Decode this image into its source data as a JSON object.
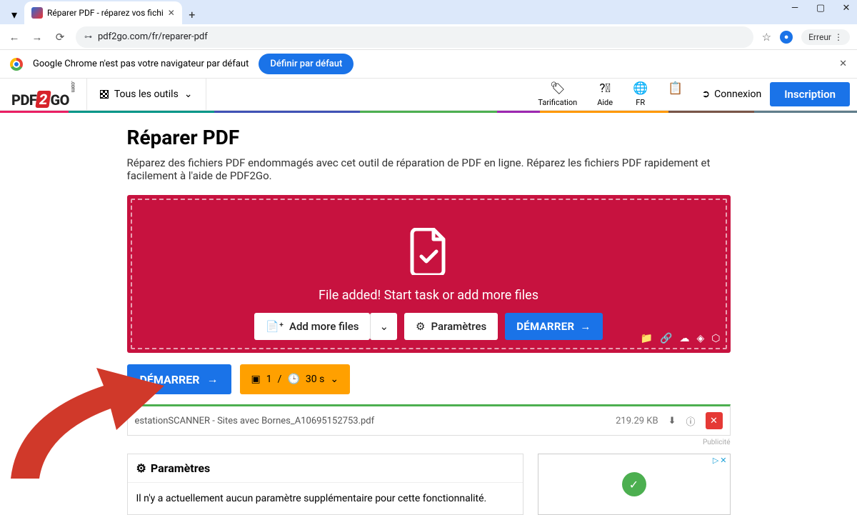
{
  "browser": {
    "tab_title": "Réparer PDF - réparez vos fichi",
    "url": "pdf2go.com/fr/reparer-pdf",
    "error_chip": "Erreur",
    "default_msg": "Google Chrome n'est pas votre navigateur par défaut",
    "define_btn": "Définir par défaut"
  },
  "header": {
    "logo_pdf": "PDF",
    "logo_num": "2",
    "logo_go": "GO",
    "tools": "Tous les outils",
    "pricing": "Tarification",
    "help": "Aide",
    "lang": "FR",
    "login": "Connexion",
    "signup": "Inscription"
  },
  "page": {
    "title": "Réparer PDF",
    "subtitle": "Réparez des fichiers PDF endommagés avec cet outil de réparation de PDF en ligne. Réparez les fichiers PDF rapidement et facilement à l'aide de PDF2Go."
  },
  "dropzone": {
    "status": "File added! Start task or add more files",
    "add_more": "Add more files",
    "settings": "Paramètres",
    "start": "DÉMARRER"
  },
  "start_btn": "DÉMARRER",
  "badge": {
    "count": "1",
    "sep": "/",
    "time": "30 s"
  },
  "file": {
    "name": "estationSCANNER - Sites avec Bornes_A10695152753.pdf",
    "size": "219.29 KB"
  },
  "publicite": "Publicité",
  "params": {
    "title": "Paramètres",
    "body": "Il n'y a actuellement aucun paramètre supplémentaire pour cette fonctionnalité."
  }
}
